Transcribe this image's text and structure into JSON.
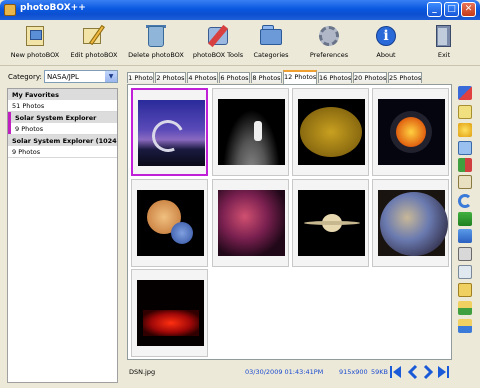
{
  "window": {
    "title": "photoBOX++",
    "minimize": "_",
    "maximize": "□",
    "close": "✕"
  },
  "toolbar": [
    {
      "key": "new",
      "label": "New photoBOX",
      "icon": "new-photobox-icon"
    },
    {
      "key": "edit",
      "label": "Edit photoBOX",
      "icon": "edit-photobox-icon"
    },
    {
      "key": "delete",
      "label": "Delete photoBOX",
      "icon": "delete-photobox-icon"
    },
    {
      "key": "tools",
      "label": "photoBOX Tools",
      "icon": "photobox-tools-icon"
    },
    {
      "key": "categories",
      "label": "Categories",
      "icon": "categories-icon"
    },
    {
      "key": "preferences",
      "label": "Preferences",
      "icon": "preferences-icon"
    },
    {
      "key": "about",
      "label": "About",
      "icon": "about-icon",
      "glyph": "i"
    },
    {
      "key": "exit",
      "label": "Exit",
      "icon": "exit-icon"
    }
  ],
  "category": {
    "label": "Category:",
    "value": "NASA/JPL",
    "arrow": "▼"
  },
  "favorites": [
    {
      "name": "My Favorites",
      "count": "51 Photos",
      "selected": false
    },
    {
      "name": "Solar System Explorer",
      "count": "9 Photos",
      "selected": true
    },
    {
      "name": "Solar System Explorer (1024...",
      "count": "9 Photos",
      "selected": false
    }
  ],
  "tabs": [
    {
      "label": "1 Photo",
      "active": false
    },
    {
      "label": "2 Photos",
      "active": false
    },
    {
      "label": "4 Photos",
      "active": false
    },
    {
      "label": "6 Photos",
      "active": false
    },
    {
      "label": "8 Photos",
      "active": false
    },
    {
      "label": "12 Photos",
      "active": true
    },
    {
      "label": "16 Photos",
      "active": false
    },
    {
      "label": "20 Photos",
      "active": false
    },
    {
      "label": "25 Photos",
      "active": false
    }
  ],
  "photos": [
    {
      "name": "deep-space-antenna",
      "selected": true
    },
    {
      "name": "moon-astronaut",
      "selected": false
    },
    {
      "name": "sun-surface",
      "selected": false
    },
    {
      "name": "solar-system",
      "selected": false
    },
    {
      "name": "planets-montage",
      "selected": false
    },
    {
      "name": "horsehead-nebula",
      "selected": false
    },
    {
      "name": "saturn",
      "selected": false
    },
    {
      "name": "mercury",
      "selected": false
    },
    {
      "name": "sun-red-flare",
      "selected": false
    }
  ],
  "status": {
    "filename": "DSN.jpg",
    "datetime": "03/30/2009 01:43:41PM",
    "dimensions": "915x900",
    "size": "59KB"
  },
  "colors": {
    "selection": "#c020d8",
    "active_tab": "#f0a030",
    "status_text": "#1a4ad0",
    "titlebar": "#0a58e0"
  }
}
